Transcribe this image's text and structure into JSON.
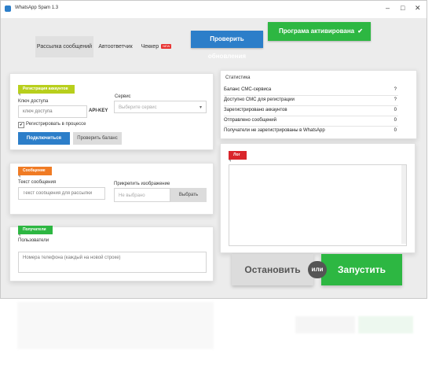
{
  "window": {
    "title": "WhatsApp Spam 1.3"
  },
  "tabs": [
    {
      "label": "Рассылка сообщений",
      "active": true
    },
    {
      "label": "Автоответчик",
      "active": false
    },
    {
      "label": "Чеккер",
      "active": false,
      "badge": "NEW"
    }
  ],
  "top_buttons": {
    "check_updates": "Проверить обновления",
    "activated": "Програма активирована",
    "check_icon": "check-icon"
  },
  "registration": {
    "title": "Регистрация аккаунтов",
    "key_label": "Ключ доступа",
    "key_placeholder": "ключ доступа",
    "api_key": "API-KEY",
    "service_label": "Сервис",
    "service_placeholder": "Выберите сервис",
    "checkbox_label": "Регистрировать в процессе",
    "connect_button": "Подключиться",
    "check_balance_button": "Проверить баланс"
  },
  "message": {
    "title": "Сообщение",
    "text_label": "Текст сообщения",
    "text_placeholder": "Текст сообщения для рассылки",
    "attach_label": "Прикрепить изображение",
    "attach_value": "Не выбрано",
    "choose_button": "Выбрать"
  },
  "recipients": {
    "title": "Получатели",
    "users_label": "Пользователи",
    "users_placeholder": "Номера телефона (каждый на новой строке)"
  },
  "statistics": {
    "title": "Статистика",
    "rows": [
      {
        "label": "Баланс СМС-сервиса",
        "value": "?"
      },
      {
        "label": "Доступно СМС для регистрации",
        "value": "?"
      },
      {
        "label": "Зарегистрировано аккаунтов",
        "value": "0"
      },
      {
        "label": "Отправлено сообщений",
        "value": "0"
      },
      {
        "label": "Получатели не зарегистрированы в WhatsApp",
        "value": "0"
      }
    ]
  },
  "log": {
    "title": "Лог"
  },
  "actions": {
    "stop": "Остановить",
    "or": "или",
    "start": "Запустить"
  },
  "colors": {
    "green": "#2db742",
    "blue": "#2c7ec9",
    "yellow": "#b8cf1c",
    "orange": "#f07b24",
    "red": "#d9252b"
  }
}
